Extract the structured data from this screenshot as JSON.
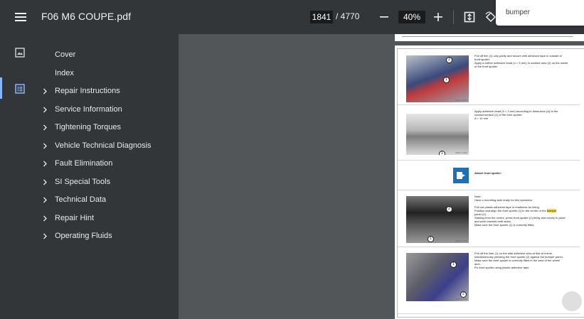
{
  "toolbar": {
    "title": "F06 M6 COUPE.pdf",
    "current_page": "1841",
    "page_total": "/ 4770",
    "zoom": "40%"
  },
  "search": {
    "text": "bumper"
  },
  "outline": {
    "items": [
      {
        "label": "Cover",
        "expandable": false
      },
      {
        "label": "Index",
        "expandable": false
      },
      {
        "label": "Repair Instructions",
        "expandable": true
      },
      {
        "label": "Service Information",
        "expandable": true
      },
      {
        "label": "Tightening Torques",
        "expandable": true
      },
      {
        "label": "Vehicle Technical Diagnosis",
        "expandable": true
      },
      {
        "label": "Fault Elimination",
        "expandable": true
      },
      {
        "label": "SI Special Tools",
        "expandable": true
      },
      {
        "label": "Technical Data",
        "expandable": true
      },
      {
        "label": "Repair Hint",
        "expandable": true
      },
      {
        "label": "Operating Fluids",
        "expandable": true
      }
    ]
  },
  "page": {
    "steps": [
      {
        "lines": [
          "Pull off film (1) only partly and secure with adhesive tape in outside of",
          "front spoiler.",
          "Apply a further adhesive bead (n = 5 mm) in marked area (2) on the inside",
          "of the front spoiler."
        ],
        "callouts": [
          "2",
          "1"
        ],
        "caption": "0000 1 2345"
      },
      {
        "lines": [
          "Apply adhesive bead (h = 3 mm) according to dimension (A) to the",
          "contact surface (1) of the front spoiler:",
          "A =                        10 mm"
        ],
        "callouts": [
          "1"
        ],
        "caption": "0000 1 2346"
      },
      {
        "lines": [
          "Attach front spoiler:"
        ]
      },
      {
        "lines": [
          "Note:",
          "Have a mounting aide ready for this operation.",
          "Pull out plastic adhesive tape in readiness for fixing.",
          "Position and align the front spoiler (1) in the centre or the bumper",
          "panel (2).",
          "Starting from the centre, press front spoiler (1) firmly and evenly in place",
          "and work towards both sides.",
          "Make sure the front spoiler (1) is correctly fitted."
        ],
        "highlight": "bumper",
        "callouts": [
          "2",
          "1"
        ],
        "caption": "0000 1 2347"
      },
      {
        "lines": [
          "Pull off the liner (1) on the side adhesive area at first at a time,",
          "simultaneously pressing the front spoiler (2) against the bumper panel.",
          "Make sure the front spoiler is correctly fitted in the area of the wheel",
          "arch.",
          "Fix front spoiler using plastic adhesive tape."
        ],
        "callouts": [
          "1",
          "2"
        ],
        "caption": "0000 1 2348"
      }
    ]
  },
  "icons": {
    "menu": "menu-icon",
    "zoom_out": "minus-icon",
    "zoom_in": "plus-icon",
    "fit": "fit-page-icon",
    "rotate": "rotate-icon",
    "thumbnails": "thumbnails-icon",
    "outline": "outline-icon",
    "chevron": "chevron-right-icon",
    "note": "note-icon"
  },
  "colors": {
    "toolbar_bg": "#323639",
    "viewer_bg": "#525659",
    "active_accent": "#8ab4f8",
    "note_icon_bg": "#1f6fb5",
    "highlight": "#f7d44a"
  }
}
